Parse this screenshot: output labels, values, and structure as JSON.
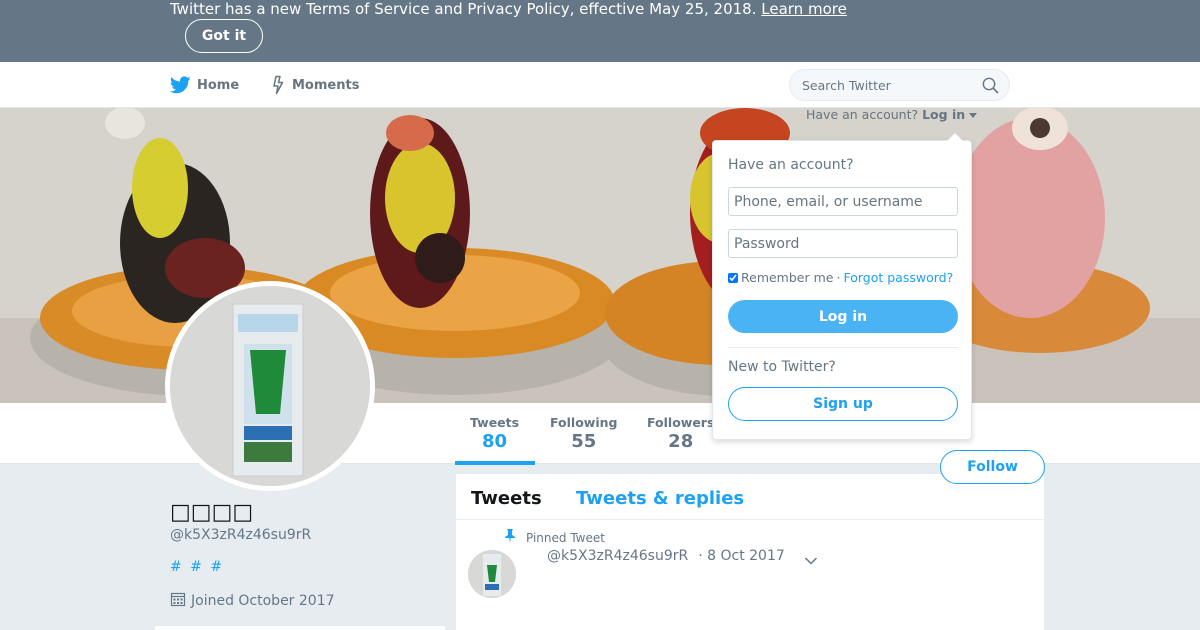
{
  "notice": {
    "text": "Twitter has a new Terms of Service and Privacy Policy, effective May 25, 2018.",
    "link_label": "Learn more",
    "dismiss_label": "Got it"
  },
  "nav": {
    "home_label": "Home",
    "moments_label": "Moments",
    "search_placeholder": "Search Twitter",
    "login_prompt": "Have an account?",
    "login_link": "Log in"
  },
  "profile": {
    "name": "□□□□",
    "handle": "@k5X3zR4z46su9rR",
    "bio": "# # #",
    "joined": "Joined October 2017"
  },
  "stats": [
    {
      "label": "Tweets",
      "value": "80"
    },
    {
      "label": "Following",
      "value": "55"
    },
    {
      "label": "Followers",
      "value": "28"
    }
  ],
  "follow_label": "Follow",
  "timeline": {
    "tabs": [
      "Tweets",
      "Tweets & replies"
    ],
    "pinned_label": "Pinned Tweet",
    "tweet": {
      "handle": "@k5X3zR4z46su9rR",
      "date": "· 8 Oct 2017"
    }
  },
  "login_card": {
    "heading": "Have an account?",
    "username_placeholder": "Phone, email, or username",
    "password_placeholder": "Password",
    "remember_label": "Remember me",
    "separator": "·",
    "forgot_label": "Forgot password?",
    "login_button": "Log in",
    "new_heading": "New to Twitter?",
    "signup_button": "Sign up"
  },
  "colors": {
    "brand": "#1da1f2",
    "notice_bg": "#657786",
    "page_bg": "#e6ecf0"
  },
  "icons": [
    "twitter-bird-icon",
    "lightning-icon",
    "search-icon",
    "caret-down-icon",
    "pin-icon",
    "calendar-icon",
    "chevron-down-icon"
  ]
}
